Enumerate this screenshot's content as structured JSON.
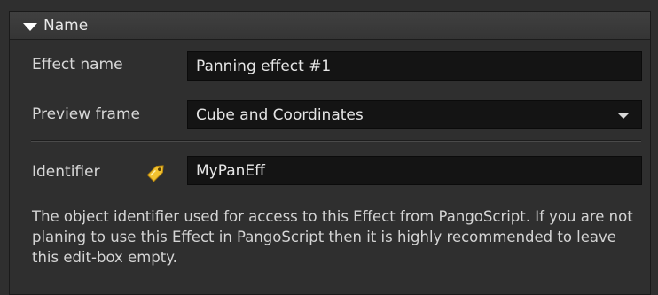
{
  "panel": {
    "title": "Name",
    "effect_name": {
      "label": "Effect name",
      "value": "Panning effect #1"
    },
    "preview_frame": {
      "label": "Preview frame",
      "selected": "Cube and Coordinates"
    },
    "identifier": {
      "label": "Identifier",
      "value": "MyPanEff",
      "icon": "tag-icon"
    },
    "description": "The object identifier used for access to this Effect from PangoScript. If you are not planing to use this Effect in PangoScript then it is highly recommended to leave this edit-box empty."
  },
  "colors": {
    "panel_bg": "#2f2f2f",
    "field_bg": "#141414",
    "text": "#d8d8d8",
    "tag_icon": "#f2c230"
  }
}
